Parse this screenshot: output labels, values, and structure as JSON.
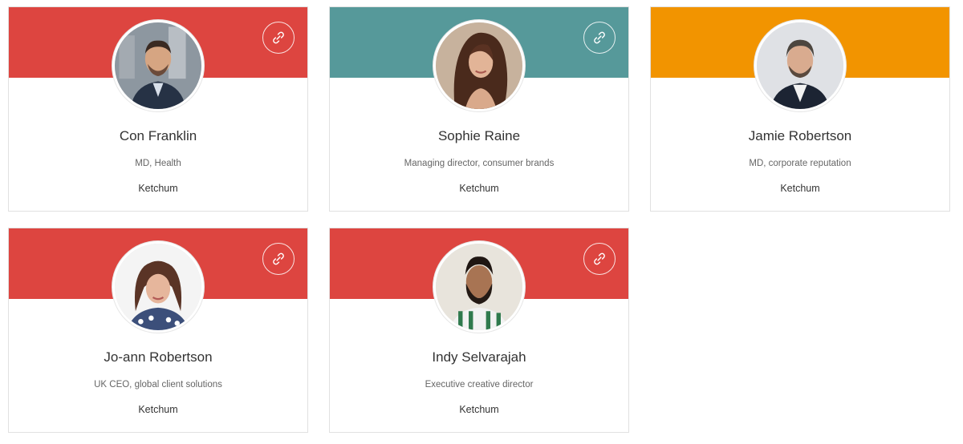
{
  "cards": [
    {
      "name": "Con Franklin",
      "role": "MD, Health",
      "company": "Ketchum",
      "banner_color": "#dd4540",
      "icon": "link-icon"
    },
    {
      "name": "Sophie Raine",
      "role": "Managing director, consumer brands",
      "company": "Ketchum",
      "banner_color": "#56999a",
      "icon": "link-icon"
    },
    {
      "name": "Jamie Robertson",
      "role": "MD, corporate reputation",
      "company": "Ketchum",
      "banner_color": "#f29400",
      "icon": null
    },
    {
      "name": "Jo-ann Robertson",
      "role": "UK CEO, global client solutions",
      "company": "Ketchum",
      "banner_color": "#dd4540",
      "icon": "link-icon"
    },
    {
      "name": "Indy Selvarajah",
      "role": "Executive creative director",
      "company": "Ketchum",
      "banner_color": "#dd4540",
      "icon": "link-icon"
    }
  ]
}
